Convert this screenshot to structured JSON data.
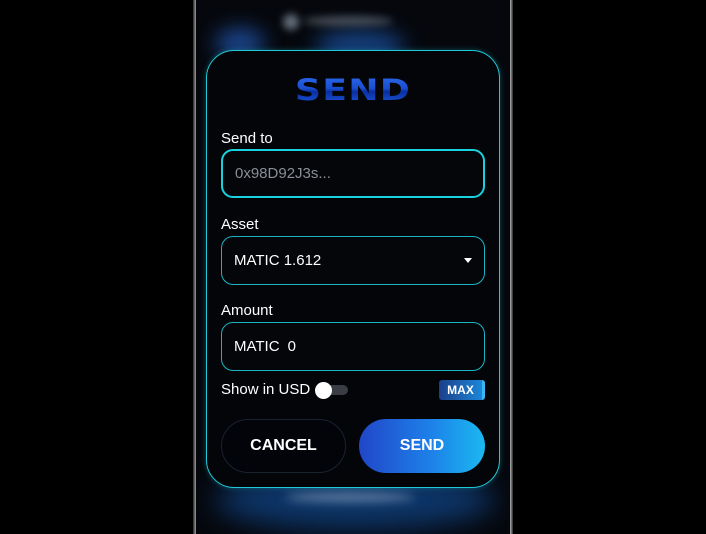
{
  "modal": {
    "title": "SEND"
  },
  "send_to": {
    "label": "Send to",
    "placeholder": "0x98D92J3s..."
  },
  "asset": {
    "label": "Asset",
    "selected": "MATIC 1.612"
  },
  "amount": {
    "label": "Amount",
    "unit": "MATIC",
    "value": "0"
  },
  "usd_toggle": {
    "label": "Show in USD",
    "enabled": false
  },
  "max_button": {
    "label": "MAX"
  },
  "actions": {
    "cancel_label": "CANCEL",
    "send_label": "SEND"
  },
  "colors": {
    "accent_cyan": "#1fc9d8",
    "send_gradient_start": "#2146c8",
    "send_gradient_end": "#1bb8f0",
    "title_blue": "#1a4fd0",
    "background": "#030509"
  },
  "icons": {
    "asset_dropdown": "caret-down-icon"
  }
}
